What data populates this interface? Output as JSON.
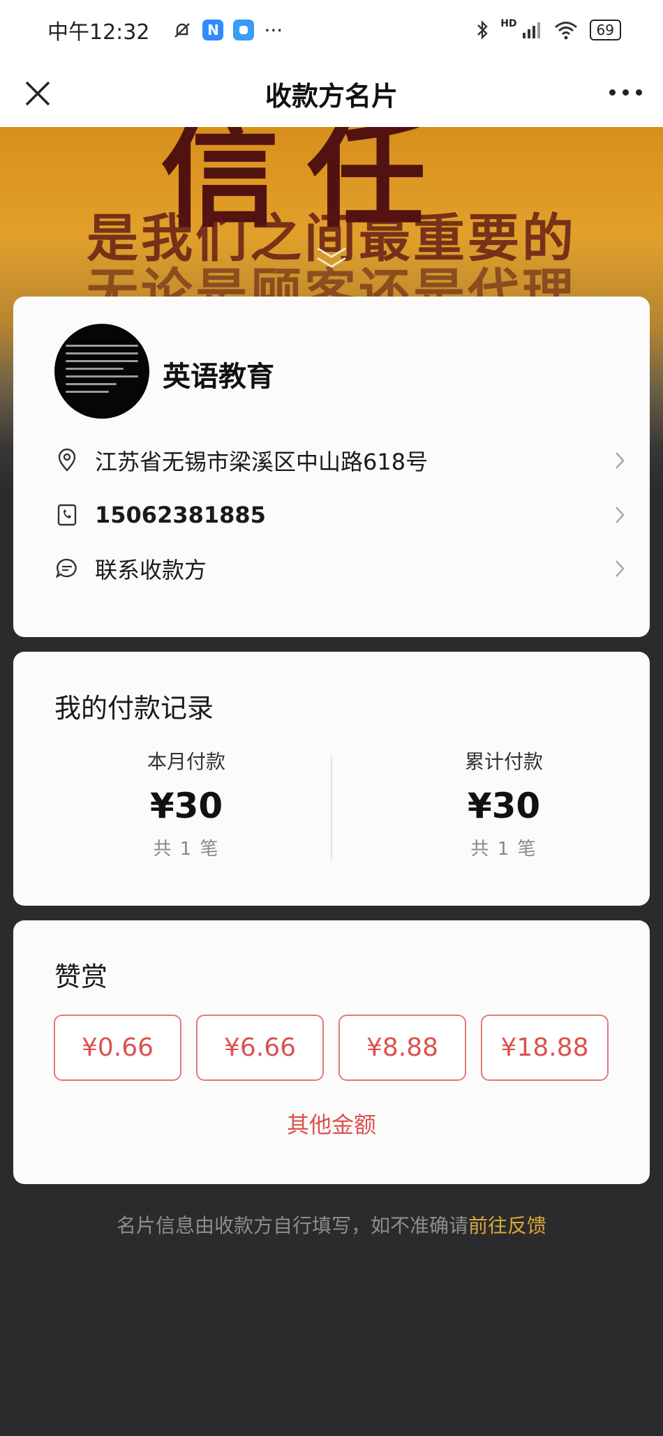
{
  "status_bar": {
    "time": "中午12:32",
    "app_badge_1": "N",
    "more": "···",
    "network": "HD",
    "battery": "69",
    "colors": {
      "badge": "#2f8cff"
    }
  },
  "nav": {
    "title": "收款方名片"
  },
  "hero": {
    "big_text": "信任",
    "line1": "是我们之间最重要的",
    "line2": "无论是顾客还是代理"
  },
  "payee": {
    "name": "英语教育",
    "address": "江苏省无锡市梁溪区中山路618号",
    "phone": "15062381885",
    "contact_label": "联系收款方"
  },
  "records": {
    "title": "我的付款记录",
    "month": {
      "label": "本月付款",
      "amount": "¥30",
      "count": "共 1 笔"
    },
    "total": {
      "label": "累计付款",
      "amount": "¥30",
      "count": "共 1 笔"
    }
  },
  "tip": {
    "title": "赞赏",
    "options": [
      "¥0.66",
      "¥6.66",
      "¥8.88",
      "¥18.88"
    ],
    "other_label": "其他金额",
    "accent_color": "#d9534f"
  },
  "footer": {
    "text": "名片信息由收款方自行填写，如不准确请",
    "link": "前往反馈",
    "link_color": "#d9a93a"
  }
}
